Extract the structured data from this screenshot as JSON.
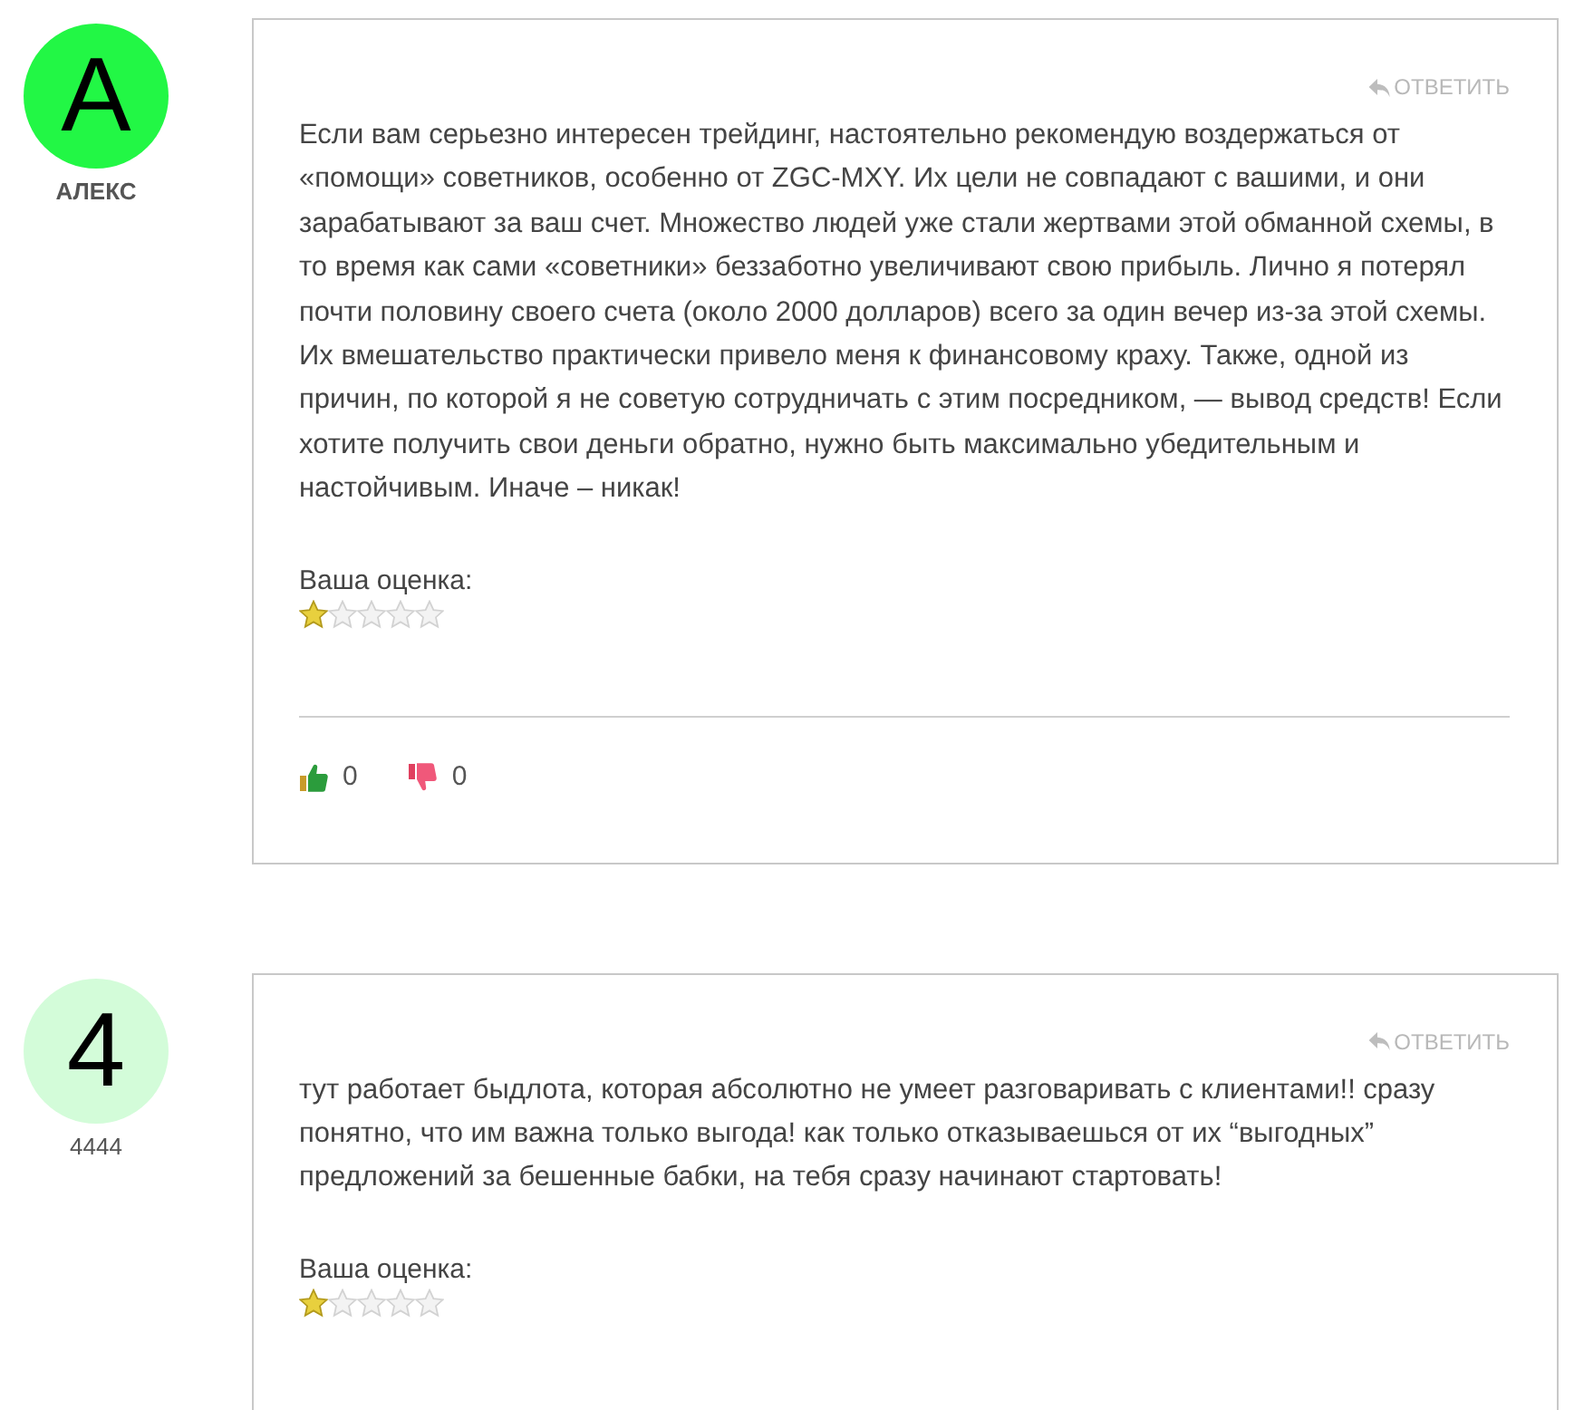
{
  "comments": [
    {
      "avatar": {
        "letter": "А",
        "color": "#22f745"
      },
      "author": "АЛЕКС",
      "author_bold": true,
      "reply_label": "ОТВЕТИТЬ",
      "text": "Если вам серьезно интересен трейдинг, настоятельно рекомендую воздержаться от «помощи» советников, особенно от ZGC-MXY. Их цели не совпадают с вашими, и они зарабатывают за ваш счет. Множество людей уже стали жертвами этой обманной схемы, в то время как сами «советники» беззаботно увеличивают свою прибыль. Лично я потерял почти половину своего счета (около 2000 долларов) всего за один вечер из-за этой схемы. Их вмешательство практически привело меня к финансовому краху. Также, одной из причин, по которой я не советую сотрудничать с этим посредником, — вывод средств! Если хотите получить свои деньги обратно, нужно быть максимально убедительным и настойчивым. Иначе – никак!",
      "rating_label": "Ваша оценка:",
      "stars": 1,
      "votes": {
        "up": "0",
        "down": "0"
      }
    },
    {
      "avatar": {
        "letter": "4",
        "color": "#d3fcd9"
      },
      "author": "4444",
      "author_bold": false,
      "reply_label": "ОТВЕТИТЬ",
      "text": "тут работает быдлота, которая абсолютно не умеет разговаривать с клиентами!! сразу понятно, что им важна только выгода! как только отказываешься от их “выгодных” предложений за бешенные бабки, на тебя сразу начинают стартовать!",
      "rating_label": "Ваша оценка:",
      "stars": 1
    }
  ]
}
